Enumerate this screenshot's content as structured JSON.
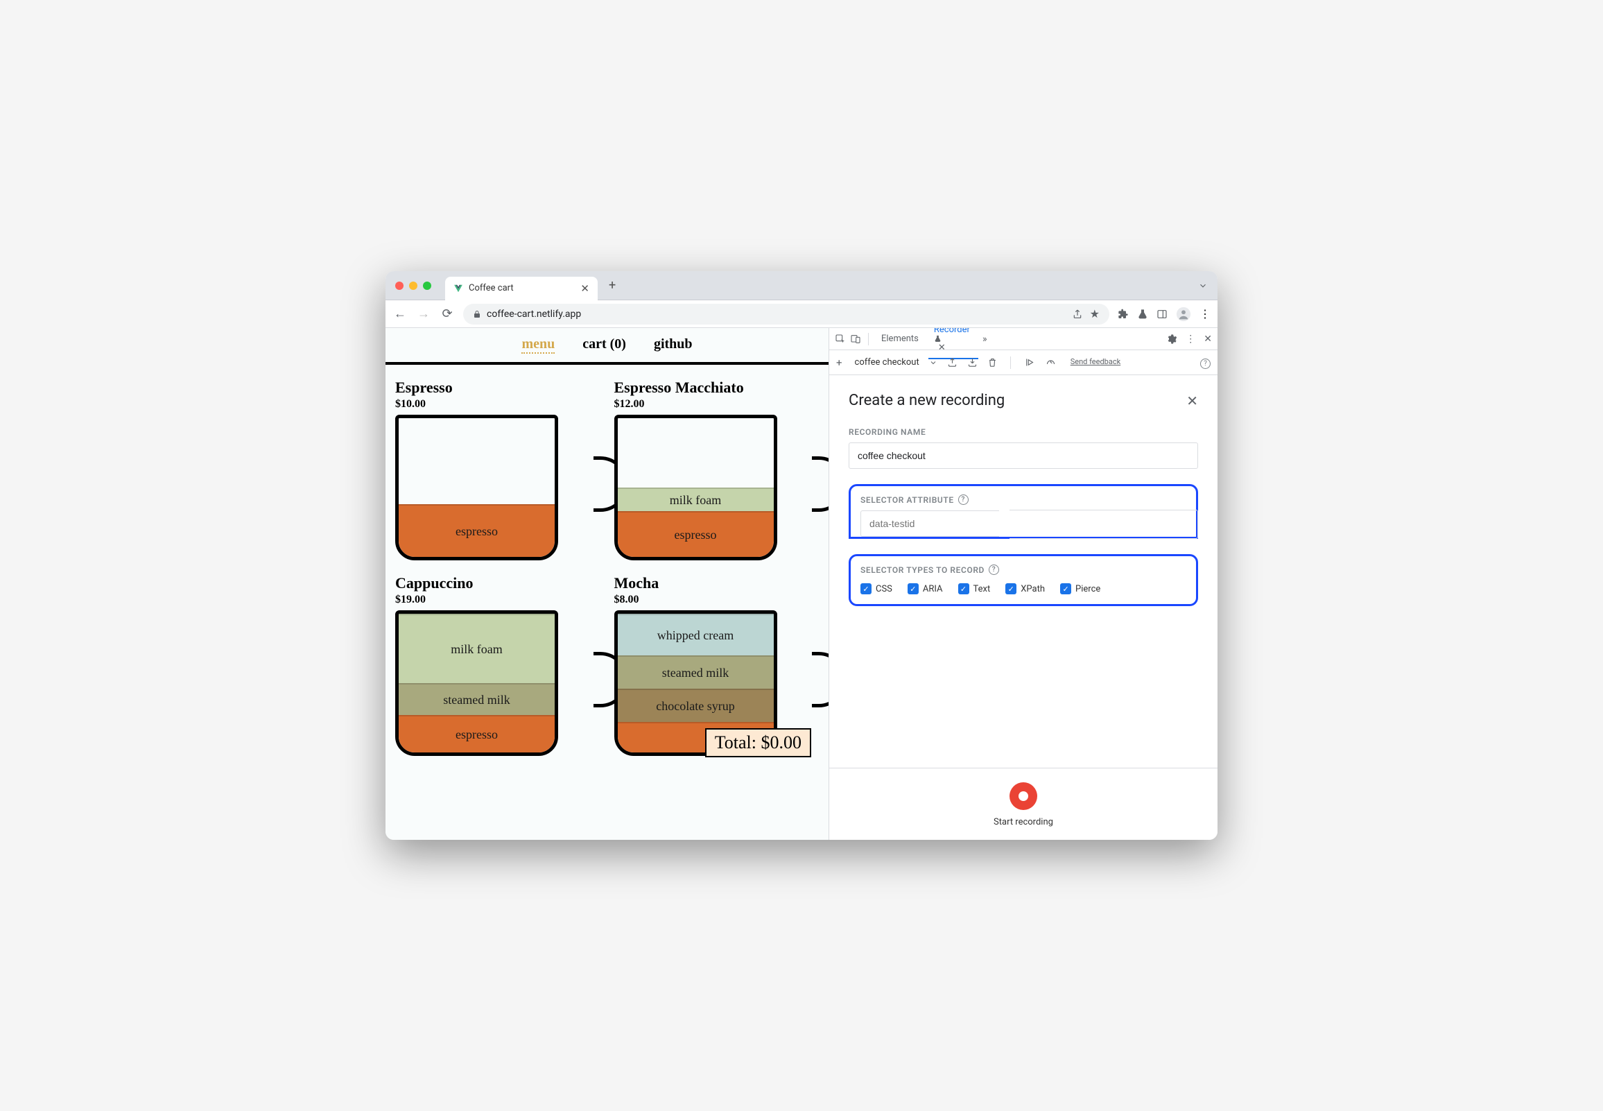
{
  "browser": {
    "tab_title": "Coffee cart",
    "url": "coffee-cart.netlify.app"
  },
  "site_nav": {
    "menu": "menu",
    "cart": "cart (0)",
    "github": "github"
  },
  "products": [
    {
      "name": "Espresso",
      "price": "$10.00"
    },
    {
      "name": "Espresso Macchiato",
      "price": "$12.00"
    },
    {
      "name": "Cappuccino",
      "price": "$19.00"
    },
    {
      "name": "Mocha",
      "price": "$8.00"
    }
  ],
  "layers": {
    "espresso": "espresso",
    "milk_foam": "milk foam",
    "steamed_milk": "steamed milk",
    "whipped_cream": "whipped cream",
    "chocolate_syrup": "chocolate syrup"
  },
  "total_label": "Total: $0.00",
  "devtools": {
    "tabs": {
      "elements": "Elements",
      "recorder": "Recorder"
    },
    "recording_name": "coffee checkout",
    "heading": "Create a new recording",
    "label_recording_name": "RECORDING NAME",
    "label_selector_attr": "SELECTOR ATTRIBUTE",
    "placeholder_selector_attr": "data-testid",
    "label_selector_types": "SELECTOR TYPES TO RECORD",
    "selector_types": [
      "CSS",
      "ARIA",
      "Text",
      "XPath",
      "Pierce"
    ],
    "start_recording": "Start recording",
    "feedback": "Send feedback"
  },
  "colors": {
    "espresso": "#d96c2e",
    "milk_foam": "#c5d4ab",
    "steamed_milk": "#a8a97e",
    "whipped_cream": "#bcd6d3",
    "chocolate_syrup": "#9c8457",
    "cream_badge": "#fde9d3"
  }
}
